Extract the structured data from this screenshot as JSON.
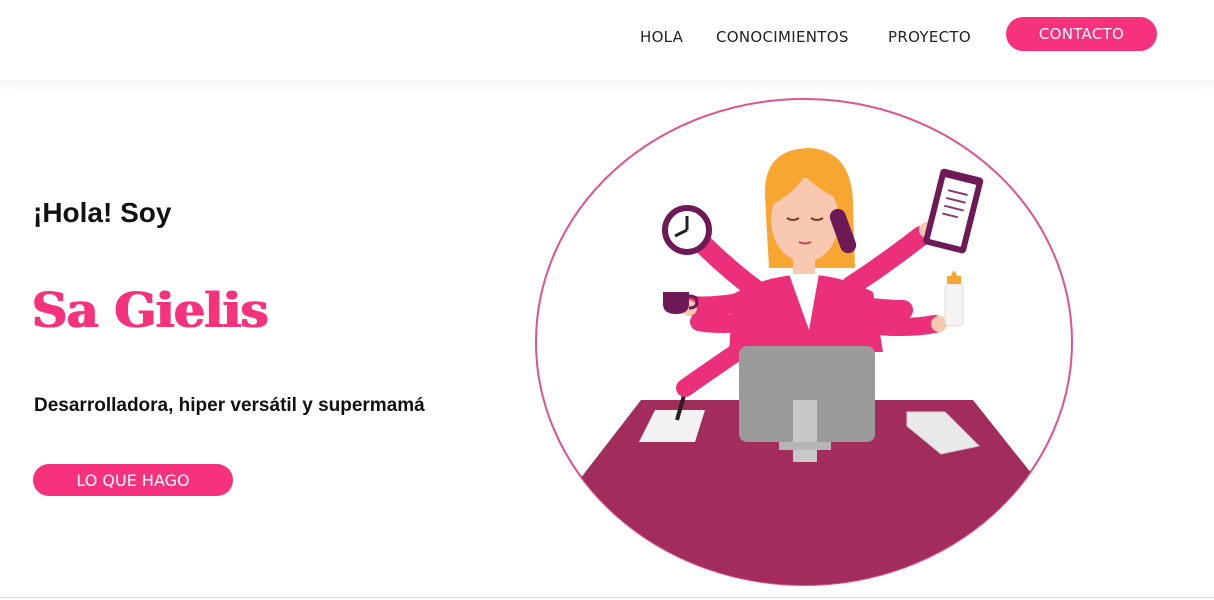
{
  "nav": {
    "items": [
      {
        "label": "HOLA"
      },
      {
        "label": "CONOCIMIENTOS"
      },
      {
        "label": "PROYECTO"
      }
    ],
    "cta_label": "CONTACTO"
  },
  "hero": {
    "greeting": "¡Hola! Soy",
    "name": "Sa Gielis",
    "tagline": "Desarrolladora, hiper versátil y supermamá",
    "button_label": "LO QUE HAGO"
  },
  "colors": {
    "accent": "#f7327c",
    "desk": "#a22c5c",
    "circle_border": "#e0528d"
  },
  "illustration": {
    "name": "multitasking-woman-illustration"
  }
}
